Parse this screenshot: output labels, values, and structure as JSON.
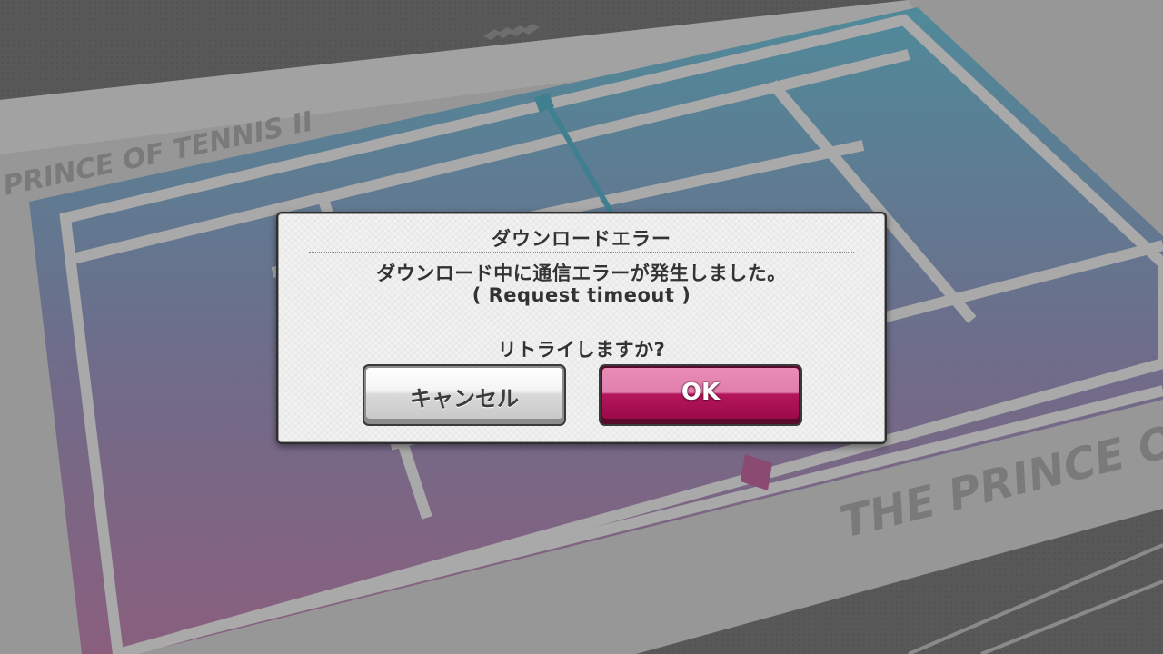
{
  "background": {
    "logo_top_left": "PRINCE OF TENNIS II",
    "logo_bottom_right": "THE PRINCE OF TEN"
  },
  "dialog": {
    "title": "ダウンロードエラー",
    "message_line1": "ダウンロード中に通信エラーが発生しました。",
    "message_line2": "( Request timeout )",
    "message_line3": "リトライしますか?",
    "cancel_label": "キャンセル",
    "ok_label": "OK"
  },
  "colors": {
    "ok_accent": "#b4165a",
    "court_blue": "#4f8c9c",
    "court_pink": "#8f5a7c"
  }
}
